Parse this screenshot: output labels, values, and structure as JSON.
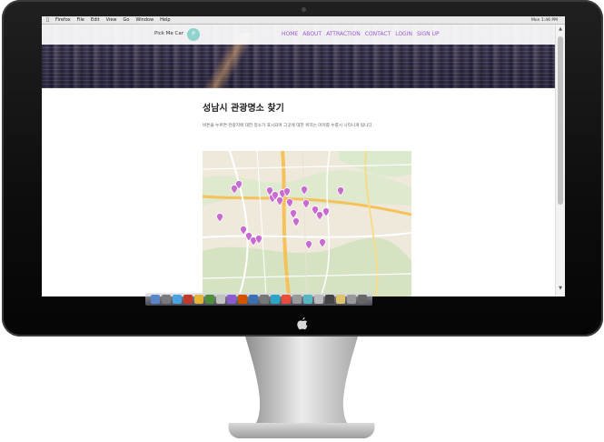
{
  "menubar": {
    "app_name": "Firefox",
    "items": [
      "File",
      "Edit",
      "View",
      "Go",
      "Window",
      "Help"
    ],
    "status": "Mon 1:46 PM"
  },
  "site": {
    "brand": "Pick Me Car",
    "logo_letter": "P",
    "nav": [
      "HOME",
      "ABOUT",
      "ATTRACTION",
      "CONTACT",
      "LOGIN",
      "SIGN UP"
    ],
    "accent_color": "#9b59d0"
  },
  "content": {
    "title": "성남시 관광명소 찾기",
    "description": "버튼을 누르면 관광지에 대한 정소가 표시되며 그곳에 대한 위치는 마커를 누를시 나타나게 됩니다."
  },
  "map": {
    "markers": 24,
    "marker_color": "#c86bd0"
  },
  "dock": {
    "icon_colors": [
      "#5a86c8",
      "#7a7a7a",
      "#4aa3e0",
      "#c0392b",
      "#e6b33b",
      "#4e8f3a",
      "#c2c2c2",
      "#8c5bd1",
      "#d35400",
      "#3b6fb6",
      "#777",
      "#2aa4c9",
      "#e74c3c",
      "#999",
      "#56b6c2",
      "#bbb",
      "#444",
      "#e0c36b",
      "#999",
      "#666"
    ]
  }
}
